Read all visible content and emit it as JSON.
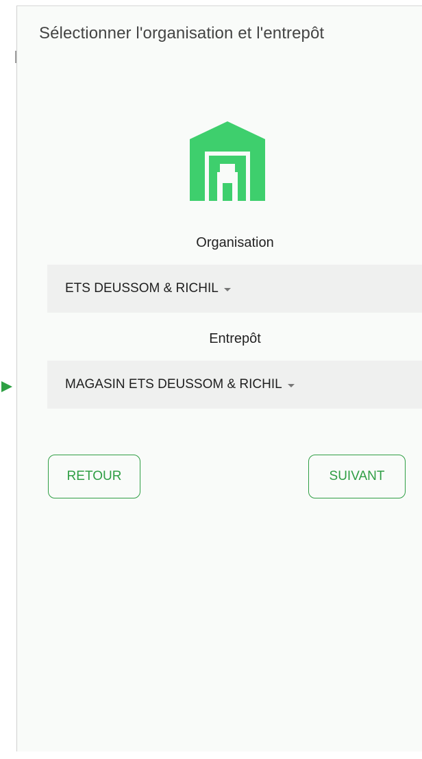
{
  "header": {
    "title": "Sélectionner l'organisation et l'entrepôt"
  },
  "icon": {
    "name": "warehouse-icon",
    "color": "#3ecf6d"
  },
  "organisation": {
    "label": "Organisation",
    "value": "ETS DEUSSOM & RICHIL"
  },
  "warehouse": {
    "label": "Entrepôt",
    "value": "MAGASIN ETS DEUSSOM & RICHIL"
  },
  "actions": {
    "back_label": "RETOUR",
    "next_label": "SUIVANT"
  },
  "colors": {
    "accent": "#2f9e44",
    "dropdown_bg": "#eff0ef",
    "pointer": "#2ea043"
  }
}
